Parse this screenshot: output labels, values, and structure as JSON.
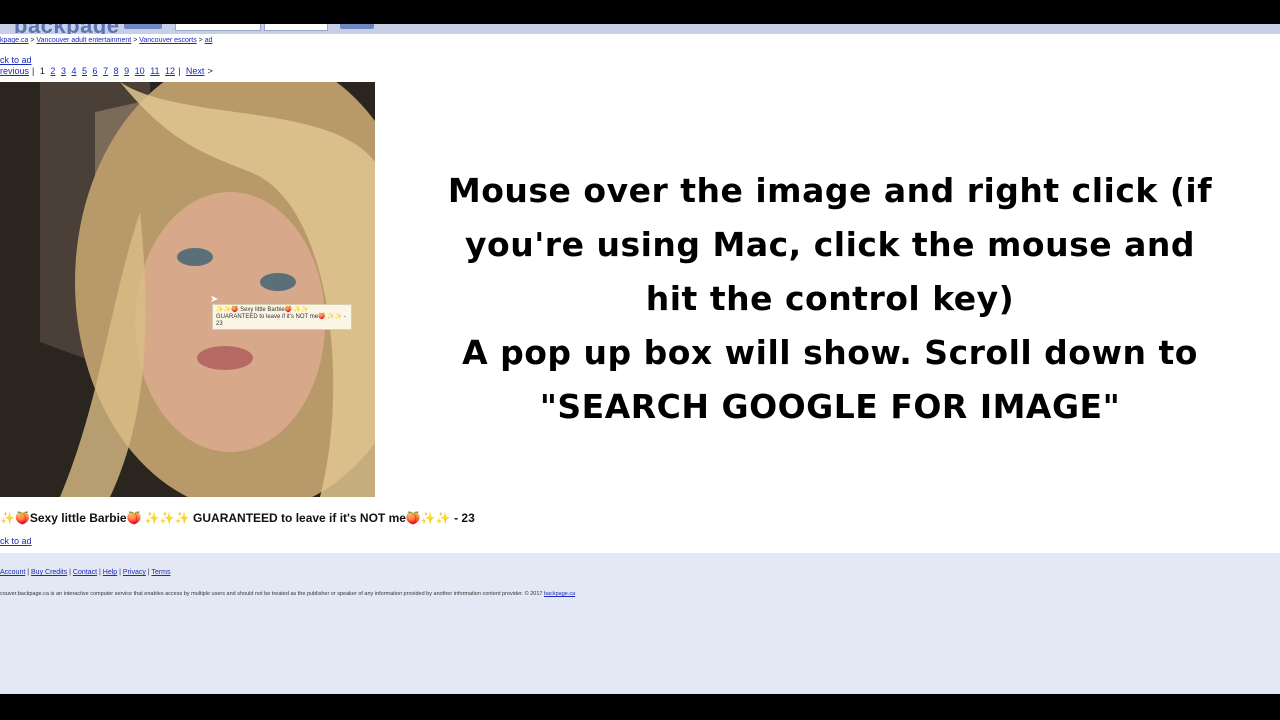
{
  "header": {
    "logo": "backpage"
  },
  "breadcrumb": {
    "items": [
      "kpage.ca",
      "Vancouver adult entertainment",
      "Vancouver escorts",
      "ad"
    ],
    "separator": ">"
  },
  "back_link": "ck to ad",
  "pager": {
    "previous": "revious",
    "current": "1",
    "pages": [
      "2",
      "3",
      "4",
      "5",
      "6",
      "7",
      "8",
      "9",
      "10",
      "11",
      "12"
    ],
    "next": "Next"
  },
  "tooltip": {
    "line1": "✨✨🍑 Sexy little Barbie🍑 ✨✨",
    "line2": "GUARANTEED to leave if it's NOT me🍑 ✨✨ -",
    "line3": "23"
  },
  "ad_title": "✨🍑Sexy little Barbie🍑 ✨✨✨ GUARANTEED to leave if it's NOT me🍑✨✨ - 23",
  "footer": {
    "links": [
      "Account",
      "Buy Credits",
      "Contact",
      "Help",
      "Privacy",
      "Terms"
    ],
    "legal": "couver.backpage.ca is an interactive computer service that enables access by multiple users and should not be treated as the publisher or speaker of any information provided by another information content provider. © 2017",
    "legal_link": "backpage.ca"
  },
  "instruction": {
    "line1": "Mouse over the image and right click (if",
    "line2": "you're using Mac, click the mouse and",
    "line3": "hit the control key)",
    "line4": "A pop up box will show. Scroll down to",
    "line5": "\"SEARCH GOOGLE FOR IMAGE\""
  },
  "colors": {
    "link": "#1a2cb8",
    "footer_bg": "#e4e8f5",
    "header_strip": "#c7cfe6"
  }
}
